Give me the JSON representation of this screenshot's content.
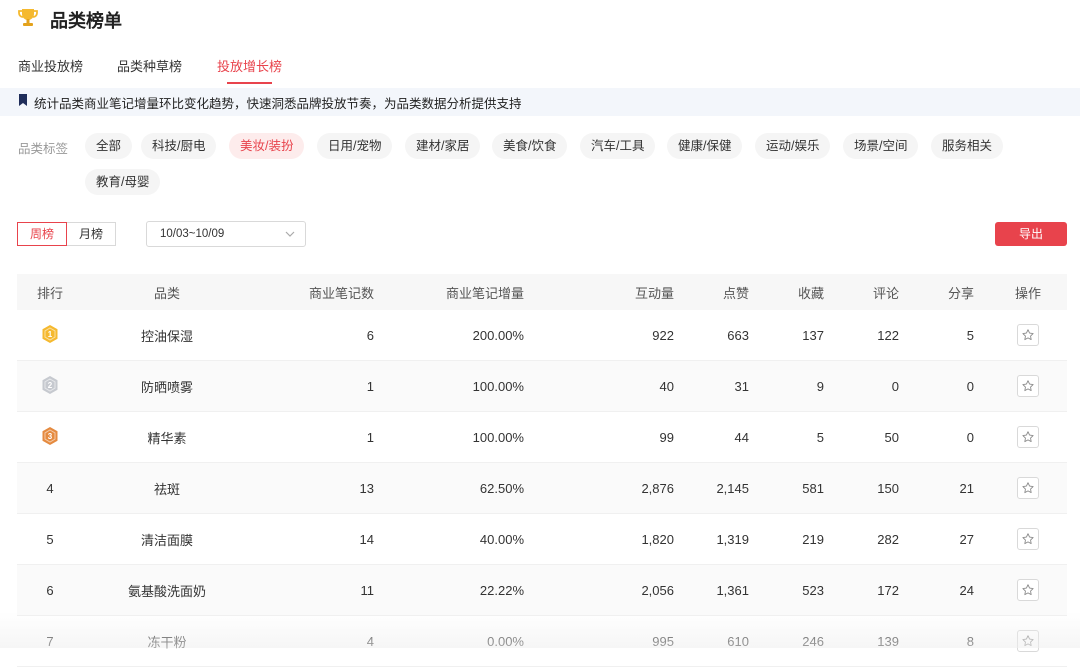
{
  "header": {
    "title": "品类榜单",
    "icon": "trophy-icon"
  },
  "tabs": [
    {
      "label": "商业投放榜",
      "active": false
    },
    {
      "label": "品类种草榜",
      "active": false
    },
    {
      "label": "投放增长榜",
      "active": true
    }
  ],
  "notice": "统计品类商业笔记增量环比变化趋势，快速洞悉品牌投放节奏，为品类数据分析提供支持",
  "filters": {
    "label": "品类标签",
    "tags": [
      {
        "label": "全部",
        "active": false
      },
      {
        "label": "科技/厨电",
        "active": false
      },
      {
        "label": "美妆/装扮",
        "active": true
      },
      {
        "label": "日用/宠物",
        "active": false
      },
      {
        "label": "建材/家居",
        "active": false
      },
      {
        "label": "美食/饮食",
        "active": false
      },
      {
        "label": "汽车/工具",
        "active": false
      },
      {
        "label": "健康/保健",
        "active": false
      },
      {
        "label": "运动/娱乐",
        "active": false
      },
      {
        "label": "场景/空间",
        "active": false
      },
      {
        "label": "服务相关",
        "active": false
      },
      {
        "label": "教育/母婴",
        "active": false
      }
    ]
  },
  "toolbar": {
    "period": [
      "周榜",
      "月榜"
    ],
    "active_period": "周榜",
    "date_range": "10/03~10/09",
    "export_label": "导出"
  },
  "colors": {
    "accent": "#e8434c",
    "gold": "#f5b92f",
    "silver": "#c6c9cf",
    "bronze": "#e58a3f"
  },
  "table": {
    "columns": [
      "排行",
      "品类",
      "商业笔记数",
      "商业笔记增量",
      "互动量",
      "点赞",
      "收藏",
      "评论",
      "分享",
      "操作"
    ],
    "rows": [
      {
        "rank": "1",
        "medal": "gold",
        "category": "控油保湿",
        "notes": "6",
        "increase": "200.00%",
        "interactions": "922",
        "likes": "663",
        "favorites": "137",
        "comments": "122",
        "shares": "5"
      },
      {
        "rank": "2",
        "medal": "silver",
        "category": "防晒喷雾",
        "notes": "1",
        "increase": "100.00%",
        "interactions": "40",
        "likes": "31",
        "favorites": "9",
        "comments": "0",
        "shares": "0"
      },
      {
        "rank": "3",
        "medal": "bronze",
        "category": "精华素",
        "notes": "1",
        "increase": "100.00%",
        "interactions": "99",
        "likes": "44",
        "favorites": "5",
        "comments": "50",
        "shares": "0"
      },
      {
        "rank": "4",
        "medal": "",
        "category": "祛斑",
        "notes": "13",
        "increase": "62.50%",
        "interactions": "2,876",
        "likes": "2,145",
        "favorites": "581",
        "comments": "150",
        "shares": "21"
      },
      {
        "rank": "5",
        "medal": "",
        "category": "清洁面膜",
        "notes": "14",
        "increase": "40.00%",
        "interactions": "1,820",
        "likes": "1,319",
        "favorites": "219",
        "comments": "282",
        "shares": "27"
      },
      {
        "rank": "6",
        "medal": "",
        "category": "氨基酸洗面奶",
        "notes": "11",
        "increase": "22.22%",
        "interactions": "2,056",
        "likes": "1,361",
        "favorites": "523",
        "comments": "172",
        "shares": "24"
      },
      {
        "rank": "7",
        "medal": "",
        "category": "冻干粉",
        "notes": "4",
        "increase": "0.00%",
        "interactions": "995",
        "likes": "610",
        "favorites": "246",
        "comments": "139",
        "shares": "8"
      }
    ]
  }
}
